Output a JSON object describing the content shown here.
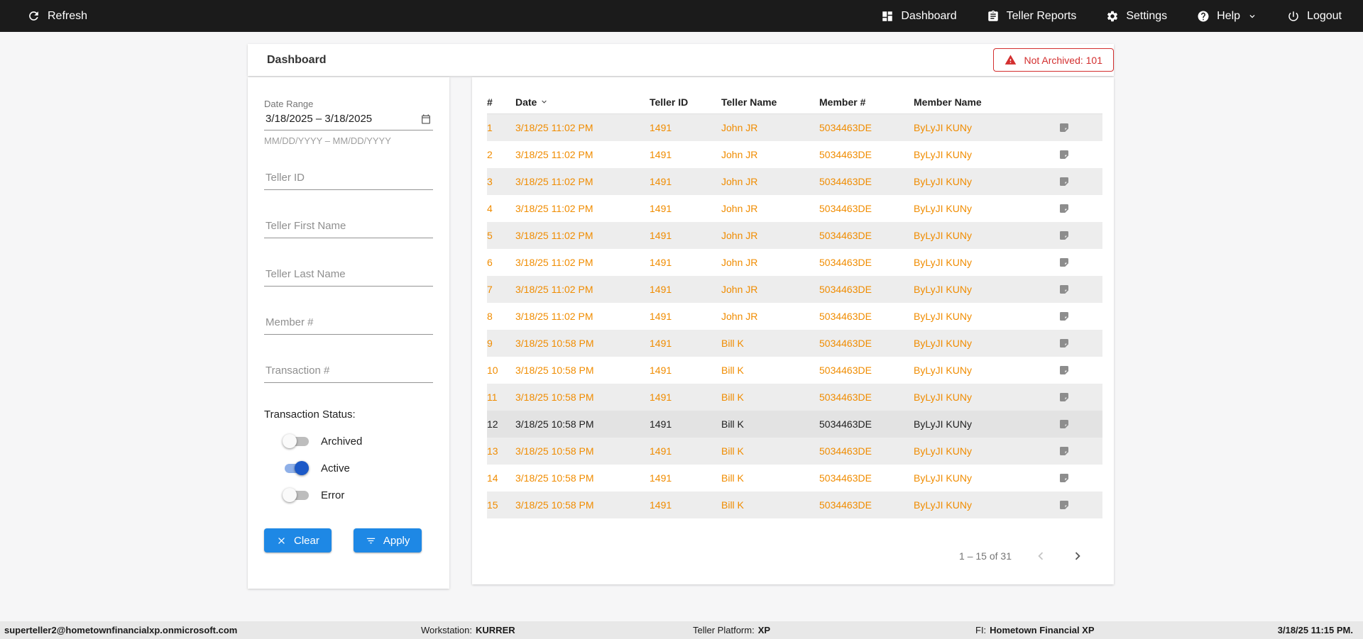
{
  "navbar": {
    "refresh_label": "Refresh",
    "dashboard_label": "Dashboard",
    "teller_reports_label": "Teller Reports",
    "settings_label": "Settings",
    "help_label": "Help",
    "logout_label": "Logout"
  },
  "header": {
    "title": "Dashboard",
    "not_archived_label": "Not Archived: 101"
  },
  "filters": {
    "date_range_label": "Date Range",
    "date_range_value": "3/18/2025 – 3/18/2025",
    "date_range_hint": "MM/DD/YYYY – MM/DD/YYYY",
    "fields": [
      "Teller ID",
      "Teller First Name",
      "Teller Last Name",
      "Member #",
      "Transaction #"
    ],
    "status_label": "Transaction Status:",
    "toggles": [
      {
        "label": "Archived",
        "on": false
      },
      {
        "label": "Active",
        "on": true
      },
      {
        "label": "Error",
        "on": false
      }
    ],
    "clear_label": "Clear",
    "apply_label": "Apply"
  },
  "table": {
    "columns": [
      "#",
      "Date",
      "Teller ID",
      "Teller Name",
      "Member #",
      "Member Name"
    ],
    "rows": [
      {
        "num": "1",
        "date": "3/18/25 11:02 PM",
        "teller_id": "1491",
        "teller_name": "John JR",
        "member_num": "5034463DE",
        "member_name": "ByLyJI KUNy",
        "highlight": false
      },
      {
        "num": "2",
        "date": "3/18/25 11:02 PM",
        "teller_id": "1491",
        "teller_name": "John JR",
        "member_num": "5034463DE",
        "member_name": "ByLyJI KUNy",
        "highlight": false
      },
      {
        "num": "3",
        "date": "3/18/25 11:02 PM",
        "teller_id": "1491",
        "teller_name": "John JR",
        "member_num": "5034463DE",
        "member_name": "ByLyJI KUNy",
        "highlight": false
      },
      {
        "num": "4",
        "date": "3/18/25 11:02 PM",
        "teller_id": "1491",
        "teller_name": "John JR",
        "member_num": "5034463DE",
        "member_name": "ByLyJI KUNy",
        "highlight": false
      },
      {
        "num": "5",
        "date": "3/18/25 11:02 PM",
        "teller_id": "1491",
        "teller_name": "John JR",
        "member_num": "5034463DE",
        "member_name": "ByLyJI KUNy",
        "highlight": false
      },
      {
        "num": "6",
        "date": "3/18/25 11:02 PM",
        "teller_id": "1491",
        "teller_name": "John JR",
        "member_num": "5034463DE",
        "member_name": "ByLyJI KUNy",
        "highlight": false
      },
      {
        "num": "7",
        "date": "3/18/25 11:02 PM",
        "teller_id": "1491",
        "teller_name": "John JR",
        "member_num": "5034463DE",
        "member_name": "ByLyJI KUNy",
        "highlight": false
      },
      {
        "num": "8",
        "date": "3/18/25 11:02 PM",
        "teller_id": "1491",
        "teller_name": "John JR",
        "member_num": "5034463DE",
        "member_name": "ByLyJI KUNy",
        "highlight": false
      },
      {
        "num": "9",
        "date": "3/18/25 10:58 PM",
        "teller_id": "1491",
        "teller_name": "Bill K",
        "member_num": "5034463DE",
        "member_name": "ByLyJI KUNy",
        "highlight": false
      },
      {
        "num": "10",
        "date": "3/18/25 10:58 PM",
        "teller_id": "1491",
        "teller_name": "Bill K",
        "member_num": "5034463DE",
        "member_name": "ByLyJI KUNy",
        "highlight": false
      },
      {
        "num": "11",
        "date": "3/18/25 10:58 PM",
        "teller_id": "1491",
        "teller_name": "Bill K",
        "member_num": "5034463DE",
        "member_name": "ByLyJI KUNy",
        "highlight": false
      },
      {
        "num": "12",
        "date": "3/18/25 10:58 PM",
        "teller_id": "1491",
        "teller_name": "Bill K",
        "member_num": "5034463DE",
        "member_name": "ByLyJI KUNy",
        "highlight": true
      },
      {
        "num": "13",
        "date": "3/18/25 10:58 PM",
        "teller_id": "1491",
        "teller_name": "Bill K",
        "member_num": "5034463DE",
        "member_name": "ByLyJI KUNy",
        "highlight": false
      },
      {
        "num": "14",
        "date": "3/18/25 10:58 PM",
        "teller_id": "1491",
        "teller_name": "Bill K",
        "member_num": "5034463DE",
        "member_name": "ByLyJI KUNy",
        "highlight": false
      },
      {
        "num": "15",
        "date": "3/18/25 10:58 PM",
        "teller_id": "1491",
        "teller_name": "Bill K",
        "member_num": "5034463DE",
        "member_name": "ByLyJI KUNy",
        "highlight": false
      }
    ],
    "pagination": "1 – 15 of 31"
  },
  "statusbar": {
    "user": "superteller2@hometownfinancialxp.onmicrosoft.com",
    "workstation_label": "Workstation:",
    "workstation_value": "KURRER",
    "platform_label": "Teller Platform:",
    "platform_value": "XP",
    "fi_label": "FI:",
    "fi_value": "Hometown Financial XP",
    "datetime": "3/18/25 11:15 PM."
  },
  "colors": {
    "accent_blue": "#1E88E5",
    "row_orange": "#F08C00",
    "alert_red": "#D32F2F",
    "navbar_black": "#1B1B1B"
  }
}
